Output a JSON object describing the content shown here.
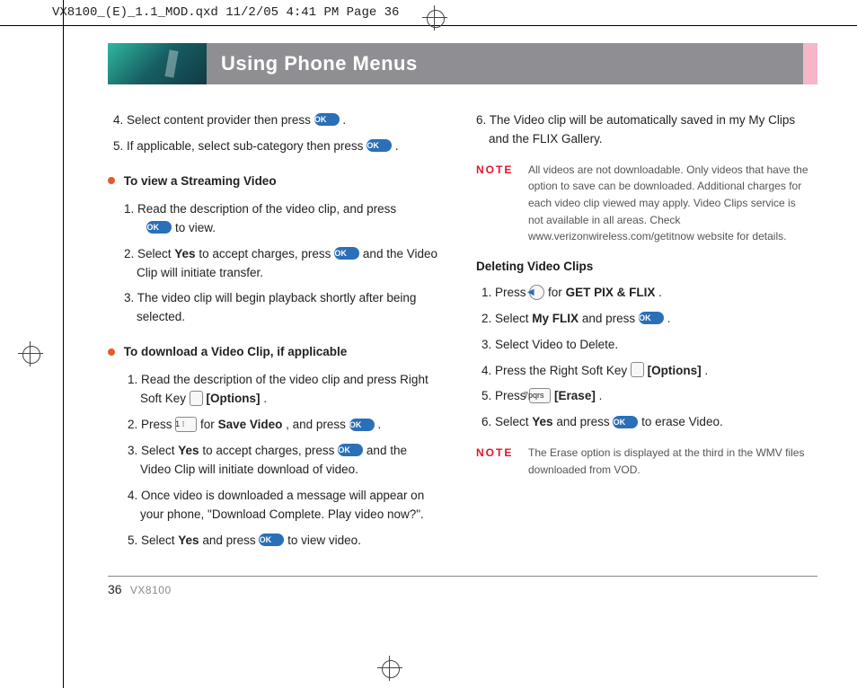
{
  "print_header": "VX8100_(E)_1.1_MOD.qxd  11/2/05  4:41 PM  Page 36",
  "banner": {
    "title": "Using Phone Menus"
  },
  "icons": {
    "ok": "OK",
    "key1": "1 ⁝",
    "key7": "7pqrs",
    "nav_left": "◀"
  },
  "left": {
    "line4_a": "4.  Select content provider then press ",
    "line4_b": " .",
    "line5_a": "5.  If applicable, select sub-category then press ",
    "line5_b": " .",
    "headA": "To view a Streaming Video",
    "a1_a": "1. Read the description of the video clip, and press ",
    "a1_b": " to view.",
    "a2_a": "2. Select ",
    "a2_yes": "Yes",
    "a2_b": " to accept charges, press ",
    "a2_c": "  and the Video Clip will initiate transfer.",
    "a3": "3. The video clip will begin playback shortly after being selected.",
    "headB": "To download a Video Clip, if applicable",
    "b1_a": "1. Read the description of the video clip and press Right Soft Key ",
    "b1_b": " ",
    "b1_opt": "[Options]",
    "b1_c": ".",
    "b2_a": "2.  Press  ",
    "b2_b": "  for ",
    "b2_save": "Save Video",
    "b2_c": ", and press ",
    "b2_d": " .",
    "b3_a": "3.  Select ",
    "b3_yes": "Yes",
    "b3_b": " to accept charges, press ",
    "b3_c": "  and the Video Clip will initiate download of video.",
    "b4": "4. Once video is downloaded a message will appear on your phone, \"Download Complete.  Play video now?\".",
    "b5_a": "5.  Select ",
    "b5_yes": "Yes",
    "b5_b": " and press ",
    "b5_c": "  to view video."
  },
  "right": {
    "line6": "6. The Video clip will be automatically saved in my My Clips and the FLIX Gallery.",
    "note1": "All videos are not downloadable. Only videos that have the option to save can be downloaded. Additional charges for each video clip viewed may apply. Video Clips service is not available in all areas. Check www.verizonwireless.com/getitnow website for details.",
    "headC": "Deleting Video Clips",
    "c1_a": "1.  Press  ",
    "c1_b": "  for  ",
    "c1_get": "GET PIX & FLIX",
    "c1_c": ".",
    "c2_a": "2.  Select ",
    "c2_my": "My FLIX",
    "c2_b": " and press ",
    "c2_c": " .",
    "c3": "3.  Select Video to Delete.",
    "c4_a": "4.  Press the Right Soft Key ",
    "c4_b": "  ",
    "c4_opt": "[Options]",
    "c4_c": ".",
    "c5_a": "5.  Press  ",
    "c5_b": "  ",
    "c5_erase": "[Erase]",
    "c5_c": ".",
    "c6_a": "6.  Select ",
    "c6_yes": "Yes",
    "c6_b": " and press ",
    "c6_c": "  to erase Video.",
    "note2": "The Erase option is displayed at the third in the WMV files downloaded from VOD."
  },
  "labels": {
    "note": "NOTE"
  },
  "footer": {
    "page": "36",
    "model": "VX8100"
  }
}
